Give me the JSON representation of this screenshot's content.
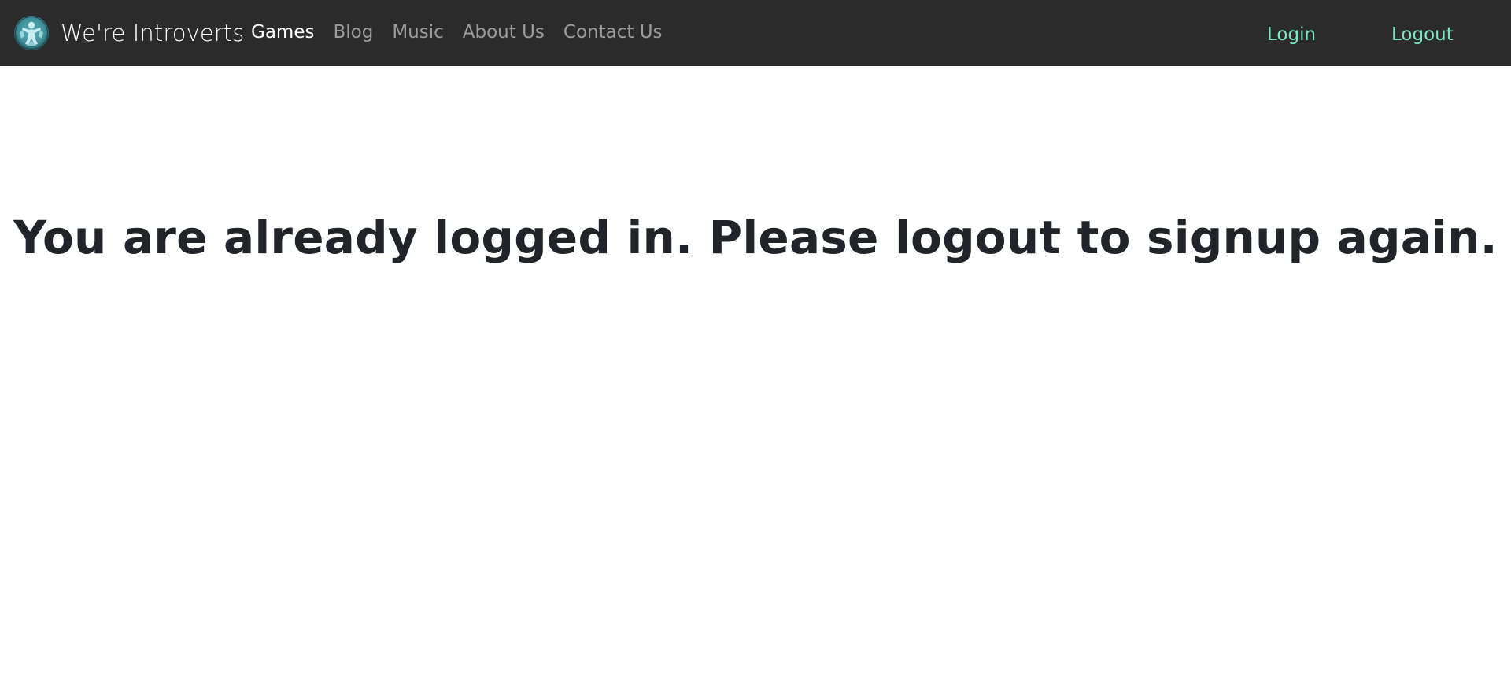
{
  "colors": {
    "navbar_bg": "#2b2b2b",
    "nav_active": "#ffffff",
    "nav_inactive": "#9c9c9c",
    "auth_link": "#7ce4c0",
    "heading": "#212529",
    "logo_teal": "#3f8f99"
  },
  "header": {
    "logo_icon": "introvert-figure-logo",
    "brand_name": "We're Introverts",
    "nav_items": [
      {
        "label": "Games",
        "active": true
      },
      {
        "label": "Blog",
        "active": false
      },
      {
        "label": "Music",
        "active": false
      },
      {
        "label": "About Us",
        "active": false
      },
      {
        "label": "Contact Us",
        "active": false
      }
    ],
    "login_label": "Login",
    "logout_label": "Logout"
  },
  "main": {
    "message": "You are already logged in. Please logout to signup again."
  }
}
